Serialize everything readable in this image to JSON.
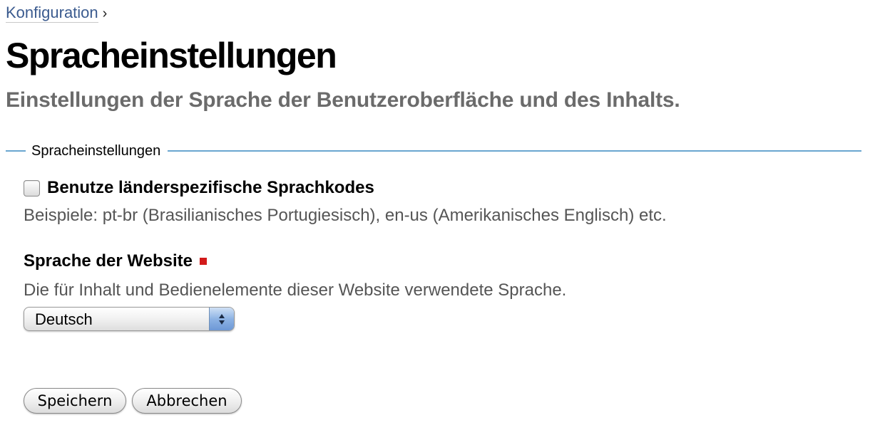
{
  "breadcrumb": {
    "parent_label": "Konfiguration",
    "separator": "›"
  },
  "page": {
    "title": "Spracheinstellungen",
    "subtitle": "Einstellungen der Sprache der Benutzeroberfläche und des Inhalts."
  },
  "fieldset": {
    "legend": "Spracheinstellungen"
  },
  "country_codes": {
    "label": "Benutze länderspezifische Sprachkodes",
    "checked": false,
    "hint": "Beispiele: pt-br (Brasilianisches Portugiesisch), en-us (Amerikanisches Englisch) etc."
  },
  "site_language": {
    "label": "Sprache der Website",
    "required": true,
    "hint": "Die für Inhalt und Bedienelemente dieser Website verwendete Sprache.",
    "selected": "Deutsch"
  },
  "actions": {
    "save_label": "Speichern",
    "cancel_label": "Abbrechen"
  },
  "colors": {
    "link": "#3b5b8f",
    "rule": "#6aa6d0",
    "subtitle": "#6b6b6b",
    "required": "#d21a1a",
    "select_arrow_accent": "#8db3e4"
  }
}
